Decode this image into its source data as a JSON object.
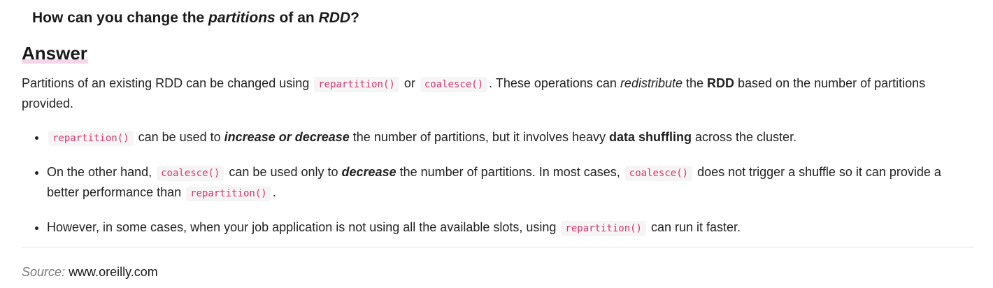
{
  "question": {
    "prefix": "How can you change the ",
    "em1": "partitions",
    "mid": " of an ",
    "em2": "RDD",
    "suffix": "?"
  },
  "answer_heading": "Answer",
  "intro": {
    "t1": "Partitions of an existing RDD can be changed using ",
    "code1": "repartition()",
    "t2": " or ",
    "code2": "coalesce()",
    "t3": ". These operations can ",
    "em": "redistribute",
    "t4": " the ",
    "strong": "RDD",
    "t5": " based on the number of partitions provided."
  },
  "bullets": [
    {
      "code1": "repartition()",
      "t1": " can be used to ",
      "strong_em": "increase or decrease",
      "t2": " the number of partitions, but it involves heavy ",
      "strong": "data shuffling",
      "t3": " across the cluster."
    },
    {
      "t1": "On the other hand, ",
      "code1": "coalesce()",
      "t2": " can be used only to ",
      "strong_em": "decrease",
      "t3": " the number of partitions. In most cases, ",
      "code2": "coalesce()",
      "t4": " does not trigger a shuffle so it can provide a better performance than ",
      "code3": "repartition()",
      "t5": "."
    },
    {
      "t1": "However, in some cases, when your job application is not using all the available slots, using ",
      "code1": "repartition()",
      "t2": " can run it faster."
    }
  ],
  "source": {
    "label": "Source:",
    "link": "www.oreilly.com"
  }
}
